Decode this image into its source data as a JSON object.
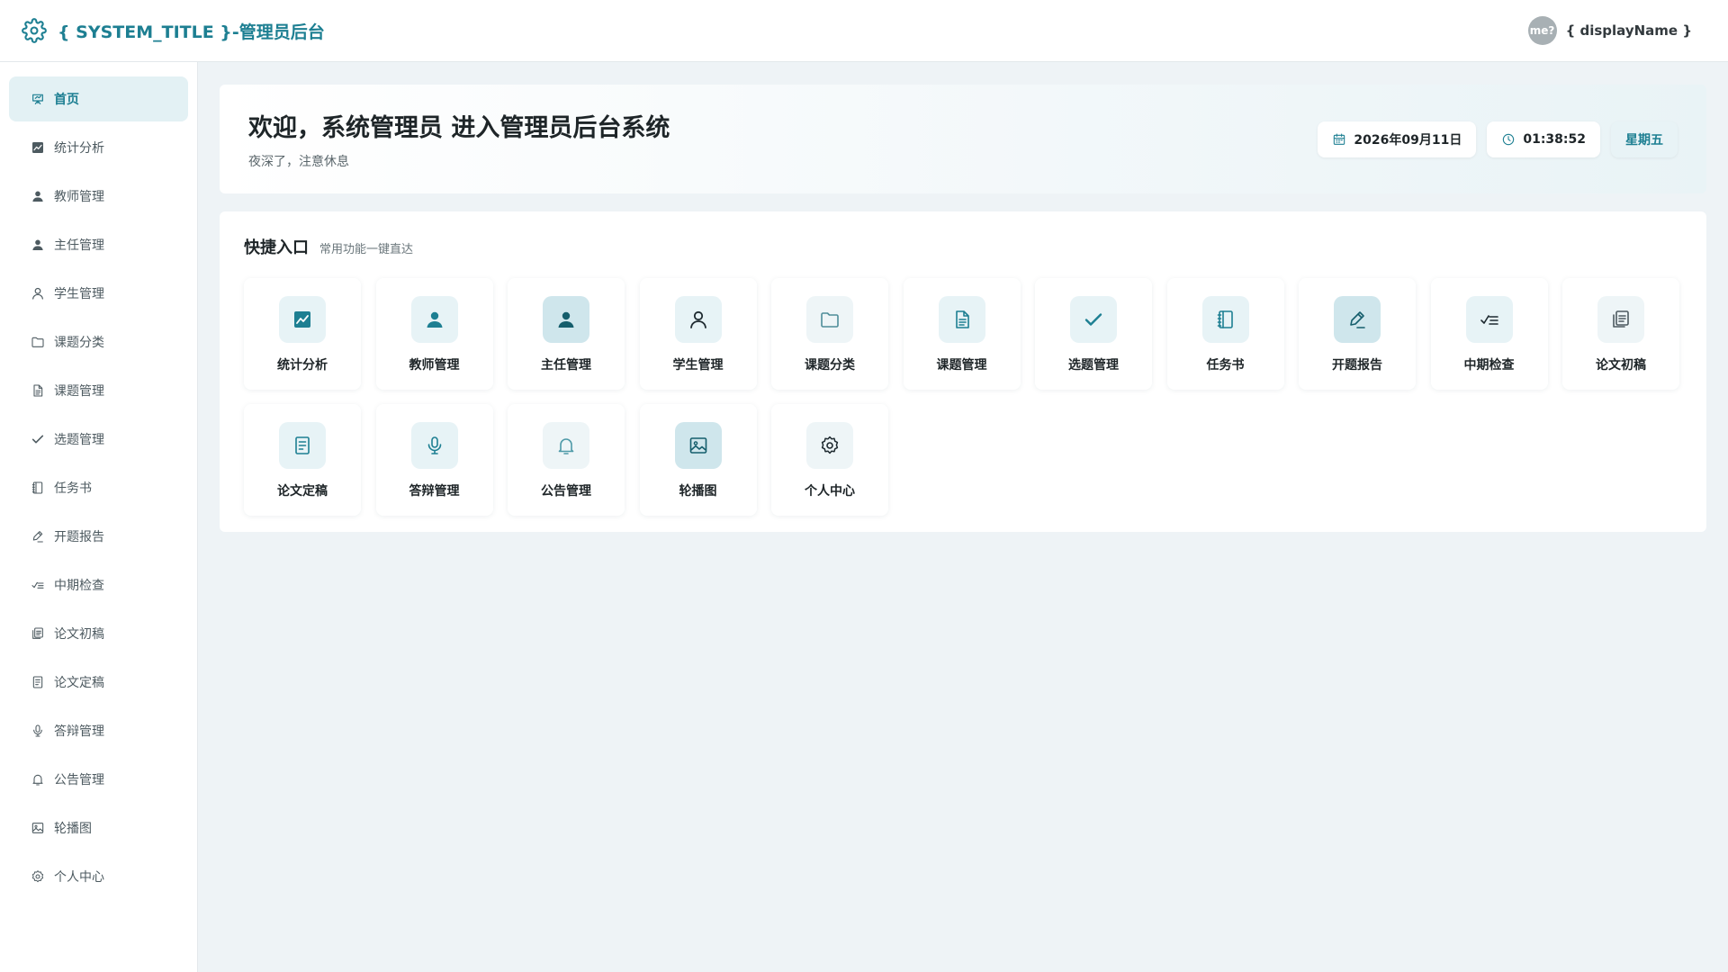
{
  "header": {
    "title": "{ SYSTEM_TITLE }-管理员后台",
    "avatar_text": "me?",
    "user_name": "{ displayName }"
  },
  "sidebar": {
    "items": [
      {
        "label": "首页",
        "icon": "home-icon"
      },
      {
        "label": "统计分析",
        "icon": "chart-icon"
      },
      {
        "label": "教师管理",
        "icon": "user-filled-icon"
      },
      {
        "label": "主任管理",
        "icon": "user-filled-icon"
      },
      {
        "label": "学生管理",
        "icon": "user-outline-icon"
      },
      {
        "label": "课题分类",
        "icon": "folder-icon"
      },
      {
        "label": "课题管理",
        "icon": "document-icon"
      },
      {
        "label": "选题管理",
        "icon": "check-icon"
      },
      {
        "label": "任务书",
        "icon": "notebook-icon"
      },
      {
        "label": "开题报告",
        "icon": "edit-pen-icon"
      },
      {
        "label": "中期检查",
        "icon": "checklist-icon"
      },
      {
        "label": "论文初稿",
        "icon": "copy-document-icon"
      },
      {
        "label": "论文定稿",
        "icon": "tickets-icon"
      },
      {
        "label": "答辩管理",
        "icon": "microphone-icon"
      },
      {
        "label": "公告管理",
        "icon": "bell-icon"
      },
      {
        "label": "轮播图",
        "icon": "picture-icon"
      },
      {
        "label": "个人中心",
        "icon": "gear-icon"
      }
    ]
  },
  "welcome": {
    "title": "欢迎，系统管理员 进入管理员后台系统",
    "subtitle": "夜深了，注意休息",
    "date": "2026年09月11日",
    "time": "01:38:52",
    "weekday": "星期五"
  },
  "quick": {
    "title": "快捷入口",
    "subtitle": "常用功能一键直达",
    "tiles": [
      {
        "label": "统计分析",
        "icon": "chart-icon"
      },
      {
        "label": "教师管理",
        "icon": "user-filled-icon"
      },
      {
        "label": "主任管理",
        "icon": "user-filled-icon"
      },
      {
        "label": "学生管理",
        "icon": "user-outline-icon"
      },
      {
        "label": "课题分类",
        "icon": "folder-icon"
      },
      {
        "label": "课题管理",
        "icon": "document-icon"
      },
      {
        "label": "选题管理",
        "icon": "check-icon"
      },
      {
        "label": "任务书",
        "icon": "notebook-icon"
      },
      {
        "label": "开题报告",
        "icon": "edit-pen-icon"
      },
      {
        "label": "中期检查",
        "icon": "checklist-icon"
      },
      {
        "label": "论文初稿",
        "icon": "copy-document-icon"
      },
      {
        "label": "论文定稿",
        "icon": "tickets-icon"
      },
      {
        "label": "答辩管理",
        "icon": "microphone-icon"
      },
      {
        "label": "公告管理",
        "icon": "bell-icon"
      },
      {
        "label": "轮播图",
        "icon": "picture-icon"
      },
      {
        "label": "个人中心",
        "icon": "gear-icon"
      }
    ]
  },
  "colors": {
    "accent": "#1d7f92",
    "active_bg": "#e3f1f4",
    "page_bg": "#eef3f6"
  }
}
